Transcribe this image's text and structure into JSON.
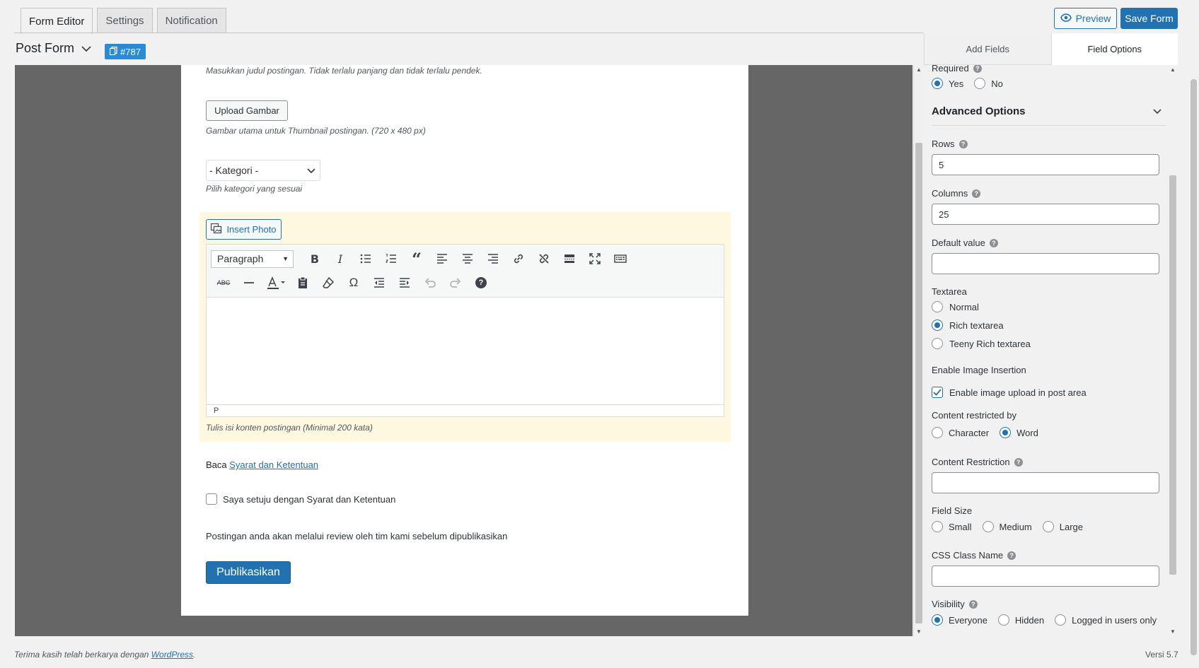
{
  "tabs": [
    {
      "label": "Form Editor",
      "active": true
    },
    {
      "label": "Settings",
      "active": false
    },
    {
      "label": "Notification",
      "active": false
    }
  ],
  "header": {
    "preview_label": "Preview",
    "save_label": "Save Form",
    "form_title": "Post Form",
    "form_id": "#787"
  },
  "form": {
    "title_help": "Masukkan judul postingan. Tidak terlalu panjang dan tidak terlalu pendek.",
    "upload_label": "Upload Gambar",
    "upload_help": "Gambar utama untuk Thumbnail postingan. (720 x 480 px)",
    "category_value": "- Kategori -",
    "category_help": "Pilih kategori yang sesuai",
    "insert_photo_label": "Insert Photo",
    "format_value": "Paragraph",
    "editor_path": "P",
    "content_help": "Tulis isi konten postingan (Minimal 200 kata)",
    "terms_prefix": "Baca",
    "terms_link": "Syarat dan Ketentuan",
    "agree_label": "Saya setuju dengan Syarat dan Ketentuan",
    "review_note": "Postingan anda akan melalui review oleh tim kami sebelum dipublikasikan",
    "publish_label": "Publikasikan"
  },
  "panel": {
    "tabs": [
      {
        "label": "Add Fields",
        "active": false
      },
      {
        "label": "Field Options",
        "active": true
      }
    ],
    "required": {
      "label": "Required",
      "options": [
        "Yes",
        "No"
      ],
      "selected": "Yes"
    },
    "advanced_title": "Advanced Options",
    "rows": {
      "label": "Rows",
      "value": "5"
    },
    "columns": {
      "label": "Columns",
      "value": "25"
    },
    "default_value": {
      "label": "Default value",
      "value": ""
    },
    "textarea": {
      "label": "Textarea",
      "options": [
        "Normal",
        "Rich textarea",
        "Teeny Rich textarea"
      ],
      "selected": "Rich textarea"
    },
    "image_insertion": {
      "label": "Enable Image Insertion",
      "checkbox_label": "Enable image upload in post area",
      "checked": true
    },
    "restricted_by": {
      "label": "Content restricted by",
      "options": [
        "Character",
        "Word"
      ],
      "selected": "Word"
    },
    "content_restriction": {
      "label": "Content Restriction",
      "value": ""
    },
    "field_size": {
      "label": "Field Size",
      "options": [
        "Small",
        "Medium",
        "Large"
      ],
      "selected": ""
    },
    "css_class": {
      "label": "CSS Class Name",
      "value": ""
    },
    "visibility": {
      "label": "Visibility",
      "options": [
        "Everyone",
        "Hidden",
        "Logged in users only"
      ],
      "selected": "Everyone"
    }
  },
  "footer": {
    "thanks_text": "Terima kasih telah berkarya dengan",
    "wp_link": "WordPress",
    "version": "Versi 5.7"
  },
  "colors": {
    "accent": "#2271b1",
    "badge": "#2a8bd2",
    "canvas": "#666666",
    "content_highlight": "#fff8e0"
  }
}
